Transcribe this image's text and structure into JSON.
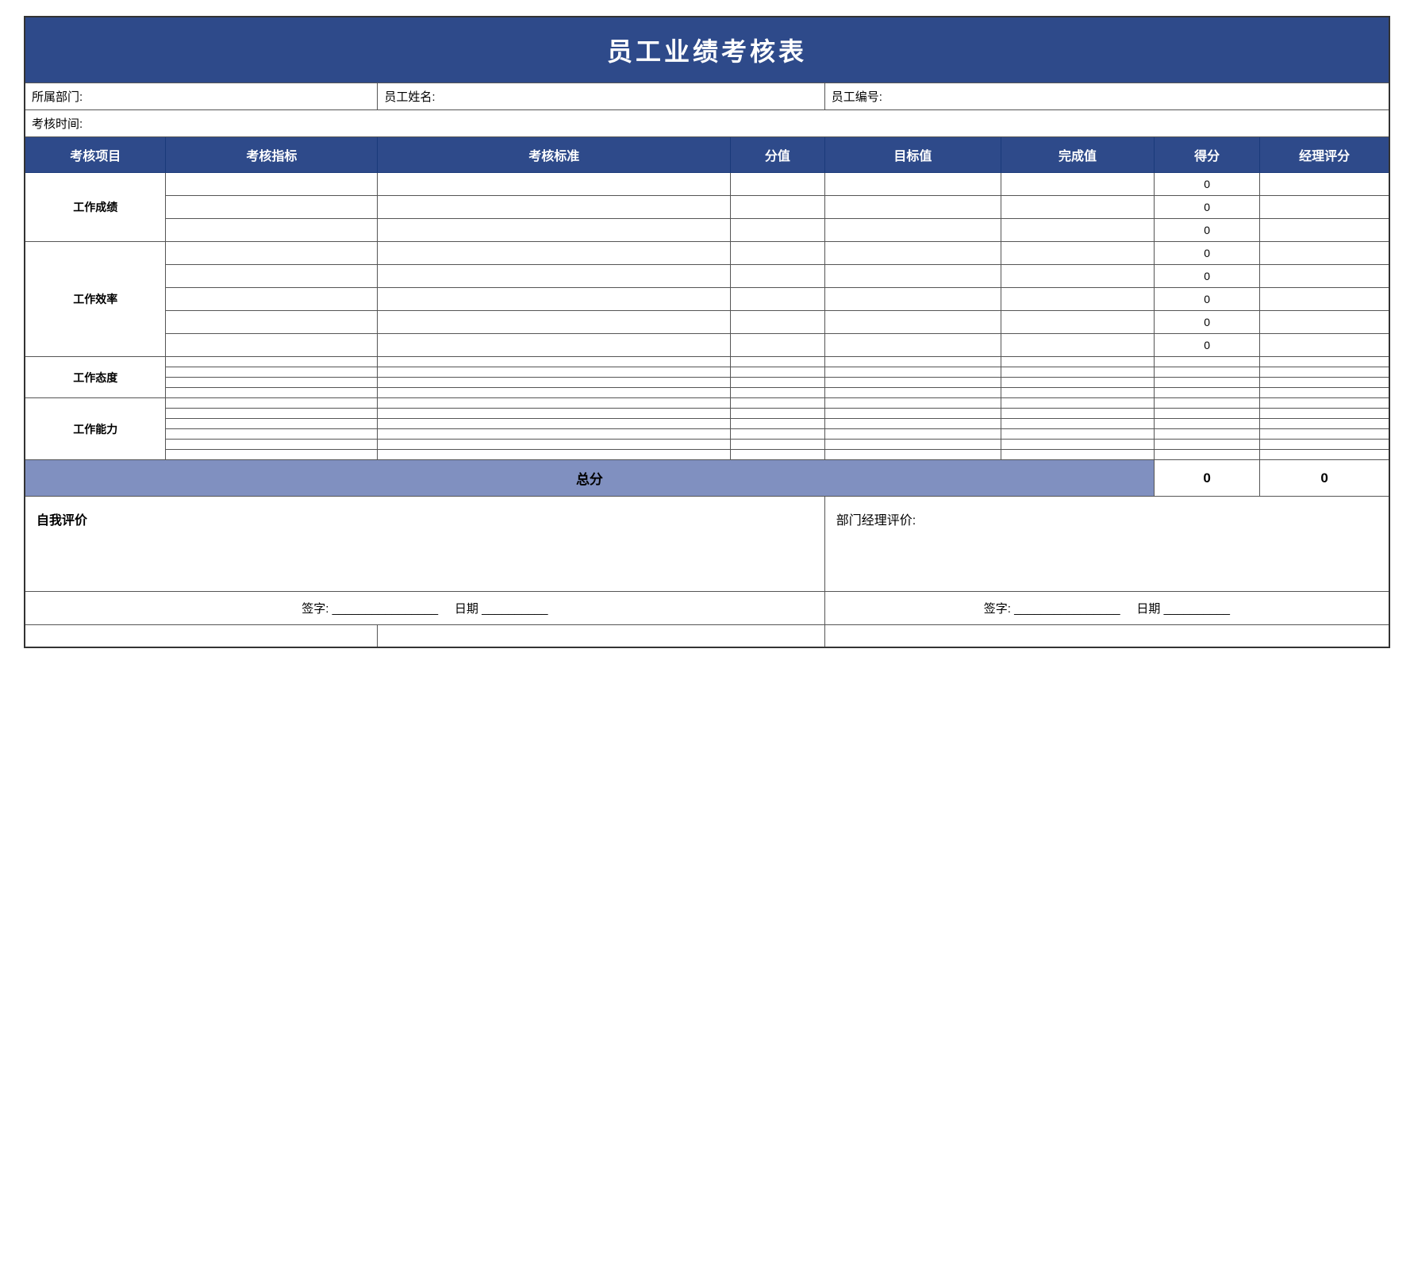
{
  "title": "员工业绩考核表",
  "info": {
    "dept_label": "所属部门:",
    "dept_value": "",
    "name_label": "员工姓名:",
    "name_value": "",
    "id_label": "员工编号:",
    "id_value": "",
    "time_label": "考核时间:",
    "time_value": ""
  },
  "headers": {
    "project": "考核项目",
    "indicator": "考核指标",
    "standard": "考核标准",
    "score": "分值",
    "target": "目标值",
    "complete": "完成值",
    "get": "得分",
    "manager": "经理评分"
  },
  "categories": [
    {
      "name": "工作成绩",
      "rows": 3
    },
    {
      "name": "工作效率",
      "rows": 5
    },
    {
      "name": "工作态度",
      "rows": 4
    },
    {
      "name": "工作能力",
      "rows": 6
    }
  ],
  "score_rows": {
    "gongzuo_jixiao": [
      {
        "get": "0",
        "manager": ""
      },
      {
        "get": "0",
        "manager": ""
      },
      {
        "get": "0",
        "manager": ""
      }
    ],
    "gongzuo_xiaolv": [
      {
        "get": "0",
        "manager": ""
      },
      {
        "get": "0",
        "manager": ""
      },
      {
        "get": "0",
        "manager": ""
      },
      {
        "get": "0",
        "manager": ""
      },
      {
        "get": "0",
        "manager": ""
      }
    ],
    "gongzuo_taidu": [
      {
        "get": "",
        "manager": ""
      },
      {
        "get": "",
        "manager": ""
      },
      {
        "get": "",
        "manager": ""
      },
      {
        "get": "",
        "manager": ""
      }
    ],
    "gongzuo_nengli": [
      {
        "get": "",
        "manager": ""
      },
      {
        "get": "",
        "manager": ""
      },
      {
        "get": "",
        "manager": ""
      },
      {
        "get": "",
        "manager": ""
      },
      {
        "get": "",
        "manager": ""
      },
      {
        "get": "",
        "manager": ""
      }
    ]
  },
  "total": {
    "label": "总分",
    "get": "0",
    "manager": "0"
  },
  "eval": {
    "self_label": "自我评价",
    "dept_label": "部门经理评价:"
  },
  "signature": {
    "left_sign_label": "签字:",
    "left_sign_line": "________________",
    "left_date_label": "日期",
    "left_date_line": "__________",
    "right_sign_label": "签字:",
    "right_sign_line": "________________",
    "right_date_label": "日期",
    "right_date_line": "__________"
  }
}
